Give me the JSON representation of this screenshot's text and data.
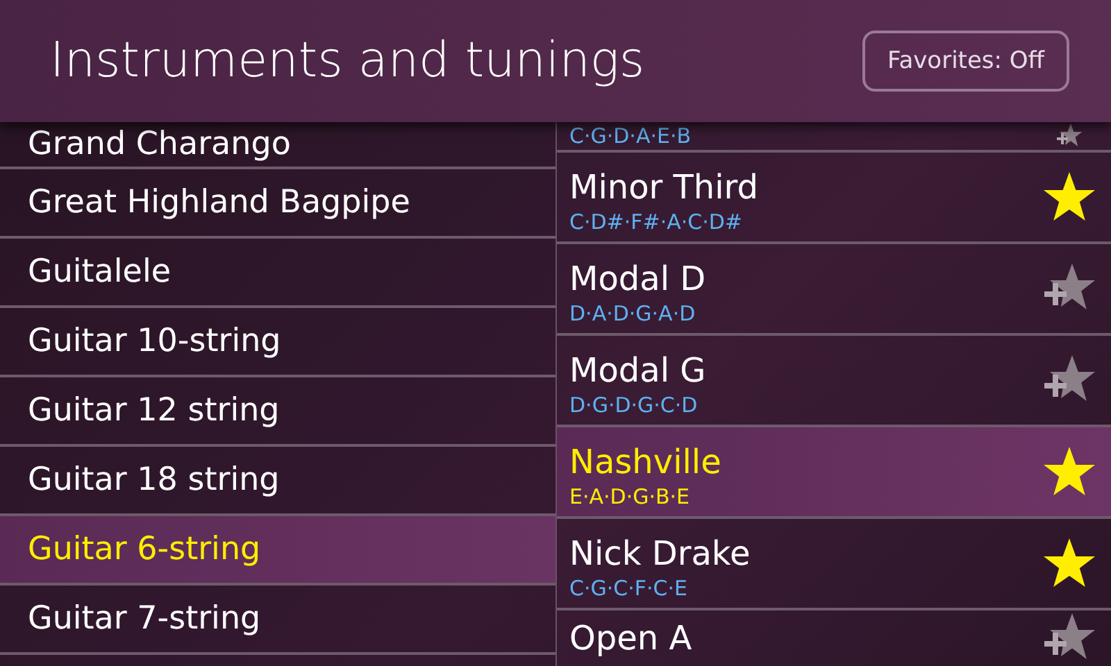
{
  "header": {
    "title": "Instruments and tunings",
    "favorites_button": "Favorites: Off"
  },
  "instruments": [
    {
      "name": "Grand Charango",
      "selected": false
    },
    {
      "name": "Great Highland Bagpipe",
      "selected": false
    },
    {
      "name": "Guitalele",
      "selected": false
    },
    {
      "name": "Guitar 10-string",
      "selected": false
    },
    {
      "name": "Guitar 12 string",
      "selected": false
    },
    {
      "name": "Guitar 18 string",
      "selected": false
    },
    {
      "name": "Guitar 6-string",
      "selected": true
    },
    {
      "name": "Guitar 7-string",
      "selected": false
    }
  ],
  "tunings": [
    {
      "notes": "C·G·D·A·E·B",
      "favorite": false,
      "selected": false
    },
    {
      "name": "Minor Third",
      "notes": "C·D#·F#·A·C·D#",
      "favorite": true,
      "selected": false
    },
    {
      "name": "Modal D",
      "notes": "D·A·D·G·A·D",
      "favorite": false,
      "selected": false
    },
    {
      "name": "Modal G",
      "notes": "D·G·D·G·C·D",
      "favorite": false,
      "selected": false
    },
    {
      "name": "Nashville",
      "notes": "E·A·D·G·B·E",
      "favorite": true,
      "selected": true
    },
    {
      "name": "Nick Drake",
      "notes": "C·G·C·F·C·E",
      "favorite": true,
      "selected": false
    },
    {
      "name": "Open A",
      "favorite": false,
      "selected": false
    }
  ]
}
